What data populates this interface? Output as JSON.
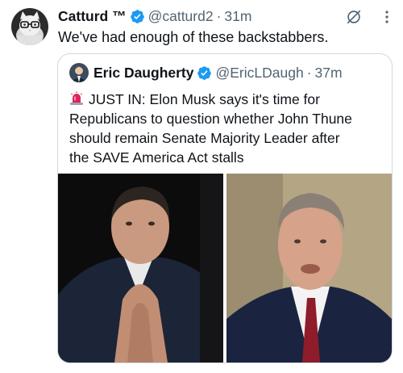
{
  "tweet": {
    "author": {
      "name": "Catturd ™",
      "handle": "@catturd2",
      "verified": true,
      "avatar_icon": "cat-avatar"
    },
    "separator": "·",
    "time": "31m",
    "text": "We've had enough of these backstabbers.",
    "actions": [
      "grok-icon",
      "more-icon"
    ],
    "quoted": {
      "author": {
        "name": "Eric Daugherty",
        "handle": "@EricLDaugh",
        "verified": true,
        "avatar_icon": "person-avatar"
      },
      "separator": "·",
      "time": "37m",
      "siren_icon": "siren-emoji",
      "text": "JUST IN: Elon Musk says it's time for\nRepublicans to question whether John Thune\nshould remain Senate Majority Leader after\nthe SAVE America Act stalls",
      "media": [
        {
          "icon": "photo-man-hands-clasped"
        },
        {
          "icon": "photo-man-speaking"
        }
      ]
    }
  },
  "colors": {
    "verified": "#1d9bf0",
    "secondary_text": "#536471",
    "border": "#cfd9de"
  }
}
